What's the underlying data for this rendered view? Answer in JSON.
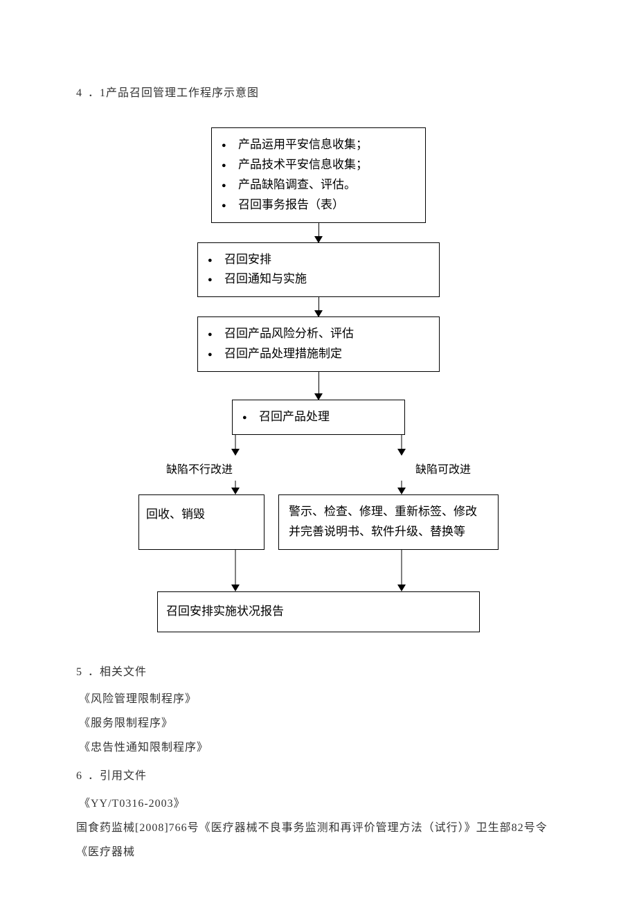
{
  "section41": {
    "num": "4",
    "label": "．1产品召回管理工作程序示意图"
  },
  "flow": {
    "box1": {
      "items": [
        "产品运用平安信息收集；",
        "产品技术平安信息收集；",
        "产品缺陷调查、评估。",
        "召回事务报告（表）"
      ]
    },
    "box2": {
      "items": [
        "召回安排",
        "召回通知与实施"
      ]
    },
    "box3": {
      "items": [
        "召回产品风险分析、评估",
        "召回产品处理措施制定"
      ]
    },
    "box4": {
      "items": [
        "召回产品处理"
      ]
    },
    "branchLeft": "缺陷不行改进",
    "branchRight": "缺陷可改进",
    "box5left": "回收、销毁",
    "box5right": "警示、检查、修理、重新标签、修改并完善说明书、软件升级、替换等",
    "box6": "召回安排实施状况报告"
  },
  "section5": {
    "num": "5",
    "label": "．相关文件",
    "refs": [
      "《风险管理限制程序》",
      "《服务限制程序》",
      "《忠告性通知限制程序》"
    ]
  },
  "section6": {
    "num": "6",
    "label": "．引用文件",
    "refs": [
      "《YY/T0316-2003》",
      "国食药监械[2008]766号《医疗器械不良事务监测和再评价管理方法（试行）》卫生部82号令《医疗器械"
    ]
  }
}
